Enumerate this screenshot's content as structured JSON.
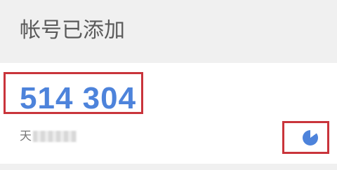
{
  "header": {
    "title": "帐号已添加"
  },
  "entry": {
    "code": "514 304",
    "account": "天",
    "timer": {
      "remaining_fraction": 0.85,
      "color": "#4d83db"
    }
  },
  "colors": {
    "accent": "#4d83db",
    "highlight_border": "#c9343b",
    "background": "#f0f0f0",
    "card": "#ffffff"
  }
}
